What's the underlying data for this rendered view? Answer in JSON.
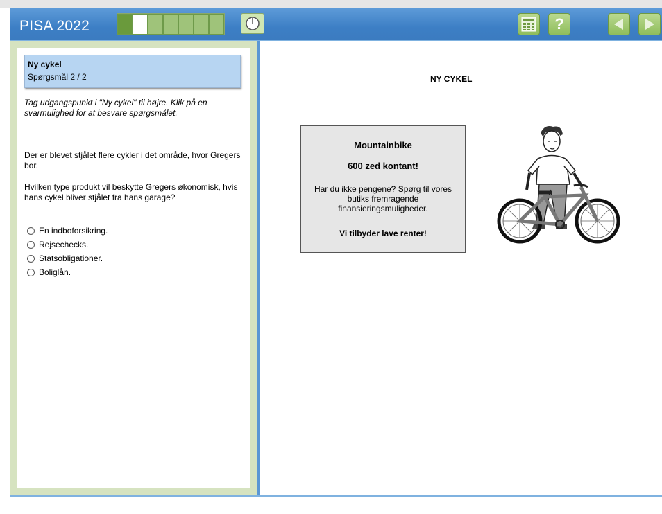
{
  "header": {
    "title": "PISA 2022",
    "progress": {
      "total": 7,
      "done": 1,
      "current": 2
    }
  },
  "icons": {
    "timer": "timer-icon",
    "calculator": "calculator-icon",
    "help": "help-icon",
    "prev": "back-arrow-icon",
    "next": "next-arrow-icon",
    "help_glyph": "?"
  },
  "question": {
    "unit_title": "Ny cykel",
    "counter": "Spørgsmål 2 / 2",
    "instruction": "Tag udgangspunkt i \"Ny cykel\" til højre. Klik på en svarmulighed for at besvare spørgsmålet.",
    "context": "Der er blevet stjålet flere cykler i det område, hvor Gregers bor.",
    "prompt": "Hvilken type produkt vil beskytte Gregers økonomisk, hvis hans cykel bliver stjålet fra hans garage?",
    "options": [
      "En indboforsikring.",
      "Rejsechecks.",
      "Statsobligationer.",
      "Boliglån."
    ]
  },
  "stimulus": {
    "title": "NY CYKEL",
    "ad": {
      "heading": "Mountainbike",
      "price": "600 zed kontant!",
      "body": "Har du ikke pengene? Spørg til vores butiks fremragende finansieringsmuligheder.",
      "offer": "Vi tilbyder lave renter!"
    }
  },
  "colors": {
    "header_blue": "#3d7fc5",
    "panel_green": "#d6e3c0",
    "question_box": "#b7d5f2",
    "button_green": "#8fbd5c"
  }
}
